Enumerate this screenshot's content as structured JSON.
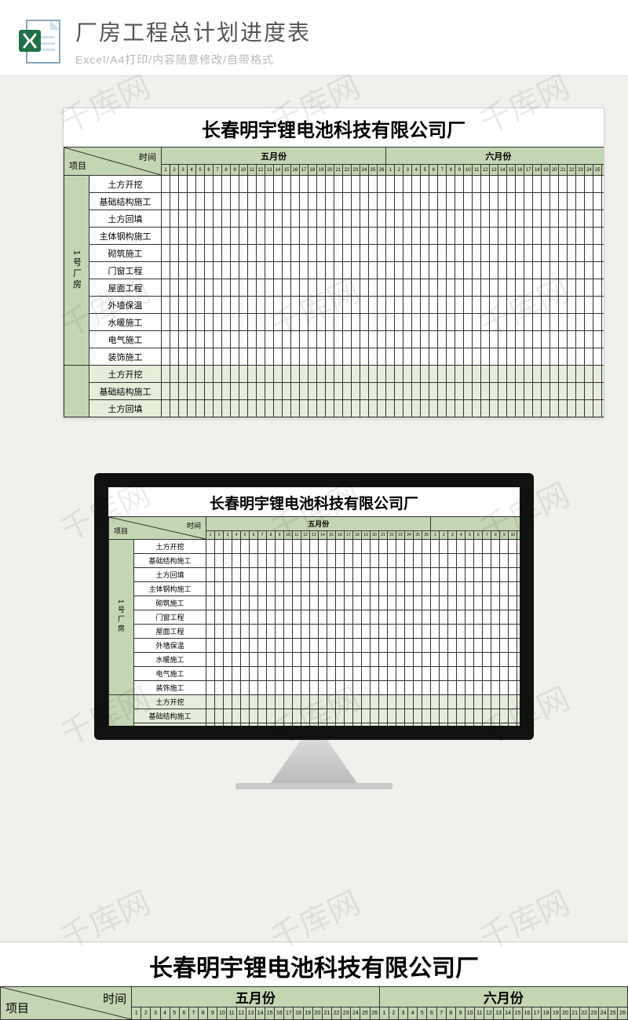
{
  "header": {
    "title": "厂房工程总计划进度表",
    "subtitle": "Excel/A4打印/内容随意修改/自带格式"
  },
  "sheet": {
    "main_title": "长春明宇锂电池科技有限公司厂",
    "corner": {
      "project": "项目",
      "time": "时间"
    },
    "months": [
      "五月份",
      "六月份"
    ],
    "group_label": "1号厂房",
    "tasks_group1": [
      "土方开挖",
      "基础结构施工",
      "土方回填",
      "主体钢构施工",
      "砌筑施工",
      "门窗工程",
      "屋面工程",
      "外墙保温",
      "水暖施工",
      "电气施工",
      "装饰施工"
    ],
    "tasks_group2": [
      "土方开挖",
      "基础结构施工",
      "土方回填"
    ],
    "days_per_month": 26
  },
  "watermark_text": "千库网"
}
